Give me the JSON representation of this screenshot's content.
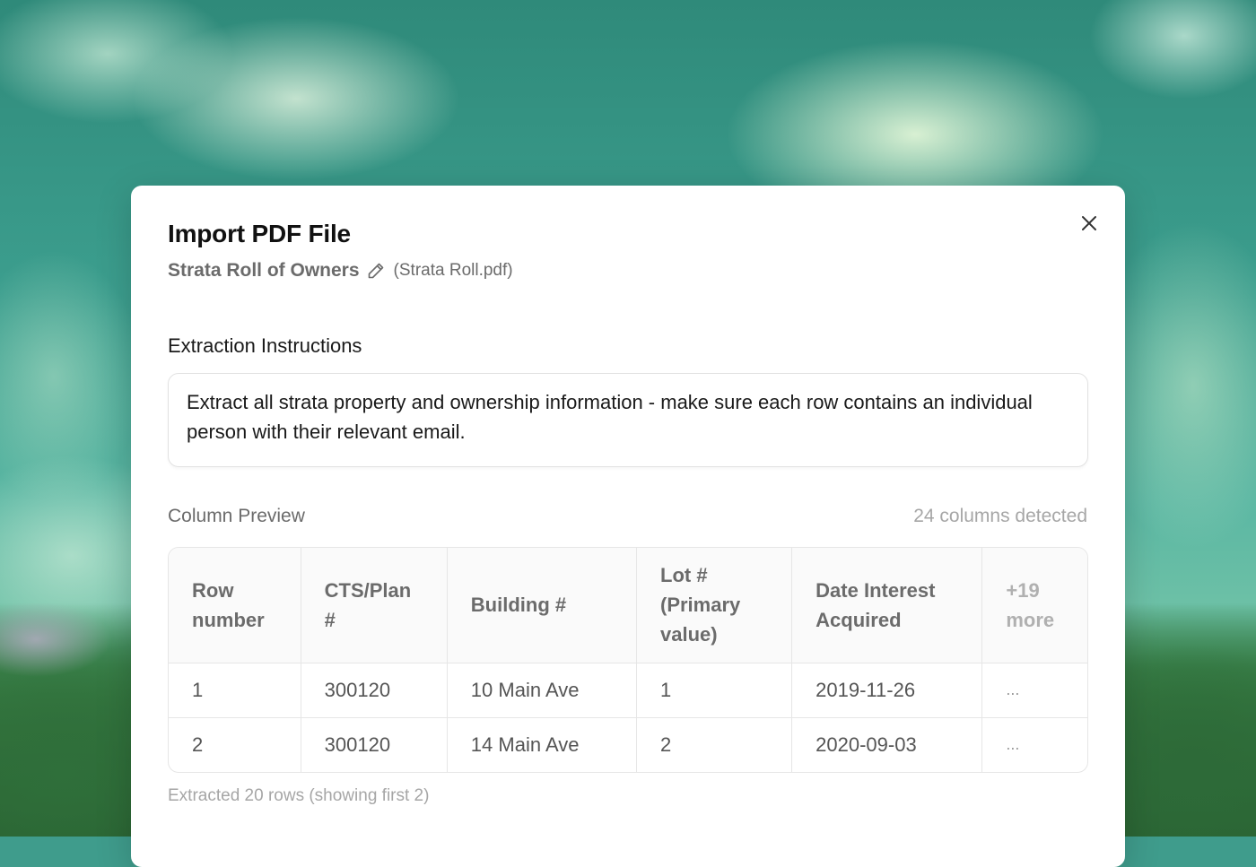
{
  "dialog": {
    "title": "Import PDF File",
    "document_name": "Strata Roll of Owners",
    "file_name": "(Strata Roll.pdf)",
    "icons": {
      "close": "close-icon",
      "edit": "pencil-icon"
    }
  },
  "instructions": {
    "label": "Extraction Instructions",
    "text": "Extract all strata property and ownership information - make sure each row contains an individual person with their relevant email."
  },
  "preview": {
    "label": "Column Preview",
    "columns_detected": "24 columns detected",
    "columns": [
      "Row number",
      "CTS/Plan #",
      "Building #",
      "Lot # (Primary value)",
      "Date Interest Acquired",
      "+19 more"
    ],
    "rows": [
      [
        "1",
        "300120",
        "10 Main Ave",
        "1",
        "2019-11-26",
        "..."
      ],
      [
        "2",
        "300120",
        "14 Main Ave",
        "2",
        "2020-09-03",
        "..."
      ]
    ],
    "footnote": "Extracted 20 rows (showing first 2)"
  }
}
